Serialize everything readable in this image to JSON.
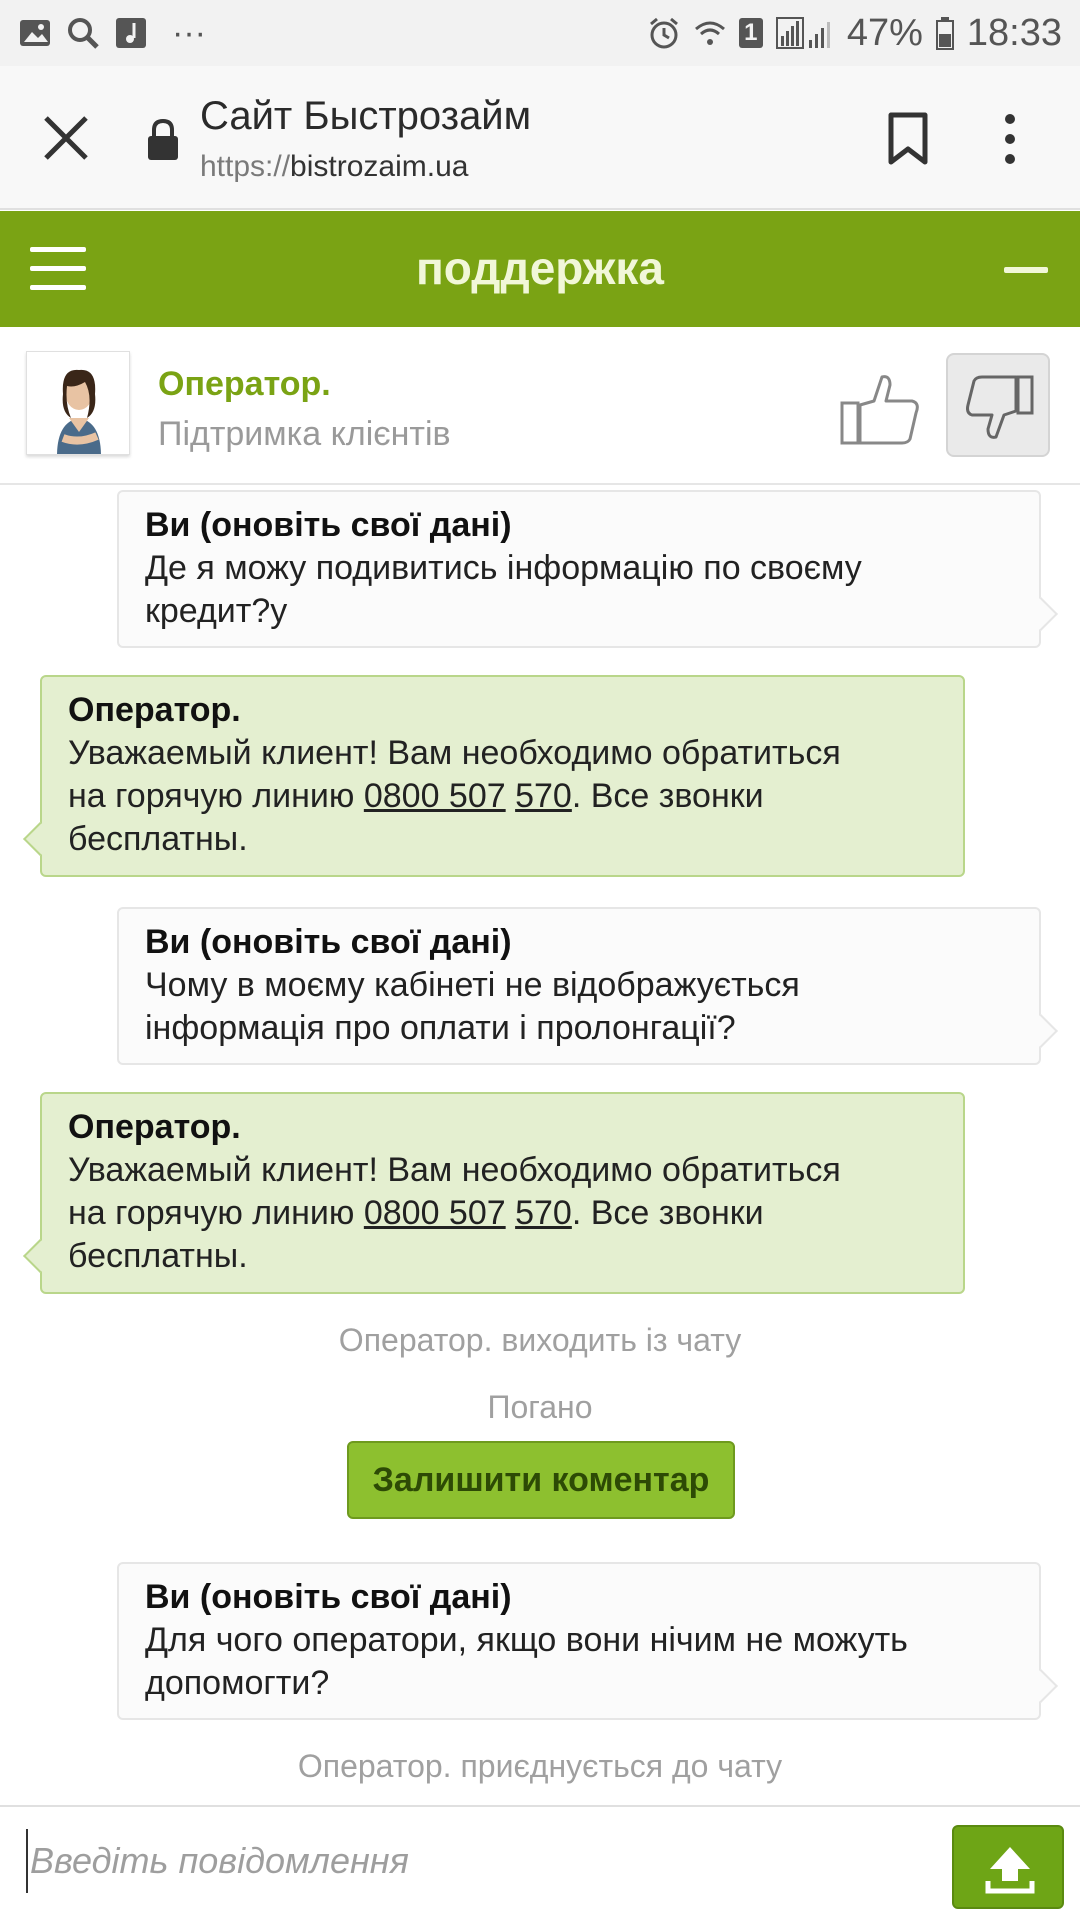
{
  "status_bar": {
    "battery_percent": "47%",
    "time": "18:33",
    "sim_badge": "1",
    "more": "···"
  },
  "browser": {
    "title": "Сайт Быстрозайм",
    "url_scheme": "https://",
    "url_host": "bistrozaim.ua"
  },
  "header": {
    "title": "поддержка"
  },
  "operator": {
    "name": "Оператор.",
    "subtitle": "Підтримка клієнтів"
  },
  "messages": [
    {
      "sender": "Ви (оновіть свої дані)",
      "line1": "Де я можу подивитись інформацію по своєму",
      "line2": "кредит?у"
    },
    {
      "sender": "Оператор.",
      "line1": "Уважаемый клиент! Вам необходимо обратиться",
      "line2_pre": "на горячую линию ",
      "phone_a": "0800 507",
      "phone_b": "570",
      "line2_post": ". Все звонки",
      "line3": "бесплатны."
    },
    {
      "sender": "Ви (оновіть свої дані)",
      "line1": "Чому в моєму кабінеті не відображується",
      "line2": "інформація про оплати і пролонгації?"
    },
    {
      "sender": "Оператор.",
      "line1": "Уважаемый клиент! Вам необходимо обратиться",
      "line2_pre": "на горячую линию ",
      "phone_a": "0800 507",
      "phone_b": "570",
      "line2_post": ". Все звонки",
      "line3": "бесплатны."
    },
    {
      "sender": "Ви (оновіть свої дані)",
      "line1": "Для чого оператори, якщо вони нічим не можуть",
      "line2": "допомогти?"
    }
  ],
  "system": {
    "left_chat": "Оператор. виходить із чату",
    "rating": "Погано",
    "comment_button": "Залишити коментар",
    "joined_chat": "Оператор. приєднується до чату"
  },
  "input": {
    "placeholder": "Введіть повідомлення",
    "value": ""
  },
  "colors": {
    "brand_green": "#7aa314",
    "operator_bubble": "#e4efd0",
    "button_green": "#8dc02f"
  },
  "icons": [
    "gallery-icon",
    "search-icon",
    "music-icon",
    "alarm-icon",
    "wifi-icon",
    "signal-icon",
    "battery-icon",
    "close-icon",
    "lock-icon",
    "bookmark-icon",
    "more-vert-icon",
    "menu-icon",
    "minimize-icon",
    "thumbs-up-icon",
    "thumbs-down-icon",
    "upload-icon"
  ]
}
